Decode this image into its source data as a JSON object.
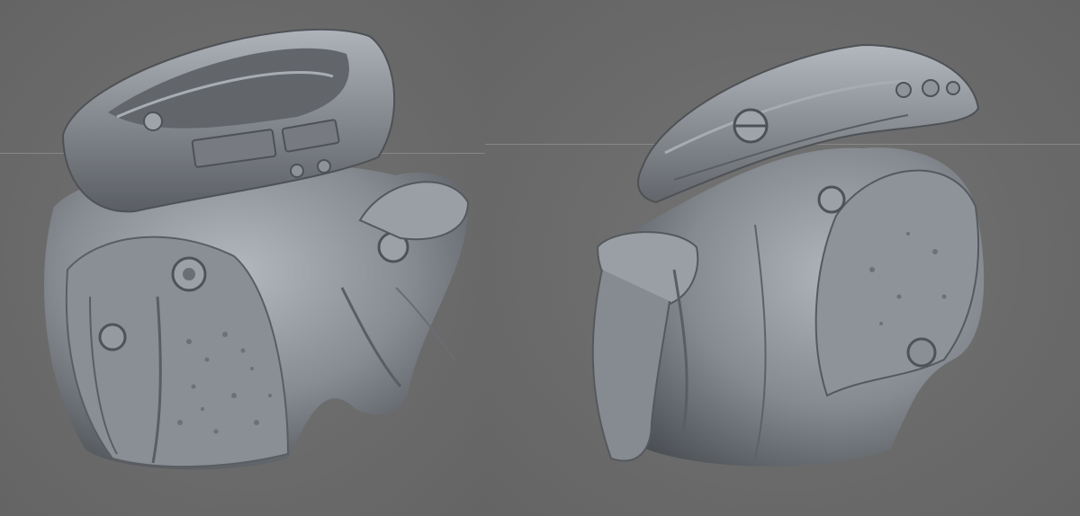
{
  "colors": {
    "background": "#6b6b6b",
    "model_base": "#8b9096",
    "model_highlight": "#b7bcc2",
    "model_shadow": "#4b4f54",
    "horizon_line": "#8e8e8e"
  },
  "viewports": [
    {
      "name": "viewport-left",
      "content": "sculpt-model-front-three-quarter"
    },
    {
      "name": "viewport-right",
      "content": "sculpt-model-side"
    }
  ]
}
